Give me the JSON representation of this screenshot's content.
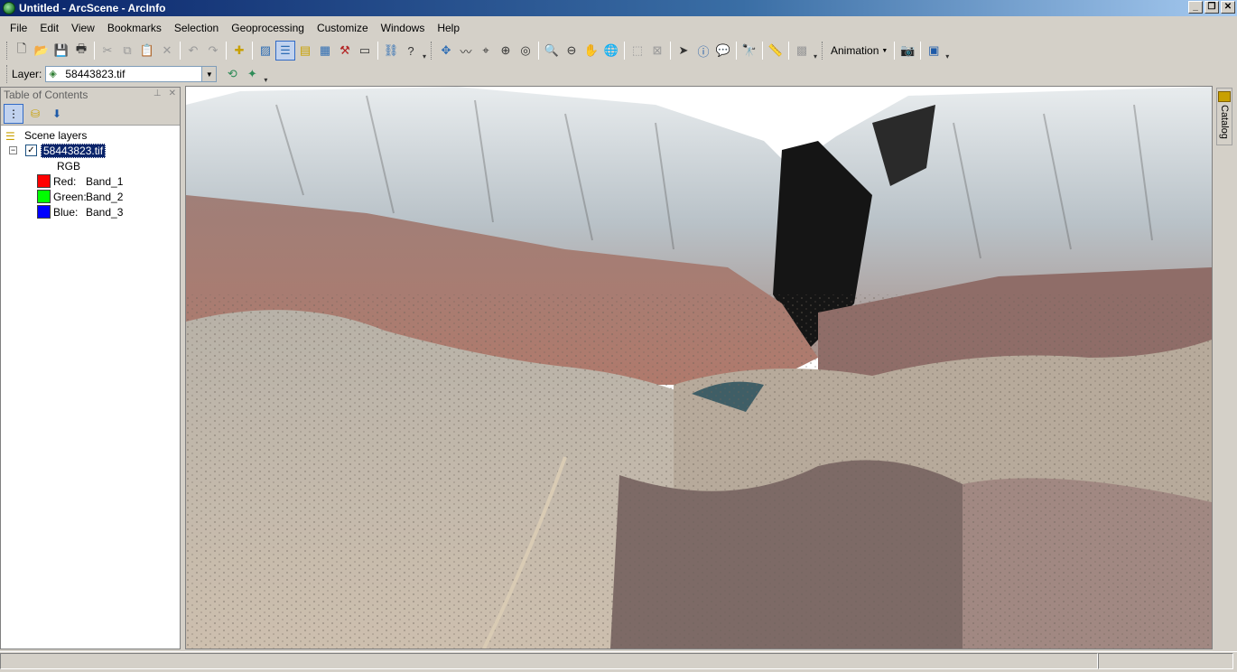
{
  "window": {
    "title": "Untitled - ArcScene - ArcInfo",
    "controls": [
      "minimize-icon",
      "restore-icon",
      "close-icon"
    ]
  },
  "menubar": {
    "items": [
      "File",
      "Edit",
      "View",
      "Bookmarks",
      "Selection",
      "Geoprocessing",
      "Customize",
      "Windows",
      "Help"
    ]
  },
  "toolbar": {
    "animation_label": "Animation"
  },
  "layerbar": {
    "label": "Layer:",
    "selected": "58443823.tif"
  },
  "toc": {
    "title": "Table of Contents",
    "scene_layers_label": "Scene layers",
    "layer": {
      "name": "58443823.tif",
      "checked": true,
      "render_type": "RGB",
      "bands": [
        {
          "channel": "Red:",
          "band": "Band_1",
          "color": "#ff0000"
        },
        {
          "channel": "Green:",
          "band": "Band_2",
          "color": "#00ff00"
        },
        {
          "channel": "Blue:",
          "band": "Band_3",
          "color": "#0000ff"
        }
      ]
    }
  },
  "side_tab": {
    "label": "Catalog"
  },
  "colors": {
    "titlebar_start": "#0a246a",
    "chrome": "#d4d0c8",
    "selection": "#0a246a"
  }
}
